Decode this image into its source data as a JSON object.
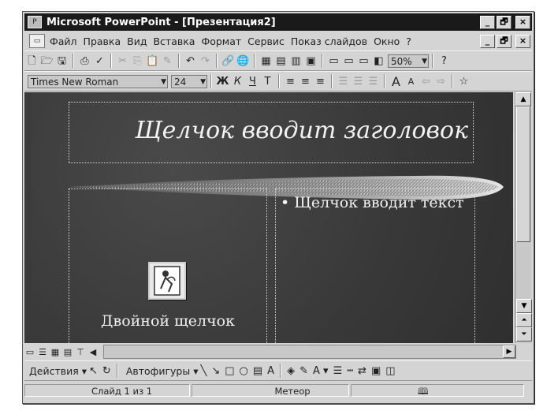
{
  "window": {
    "title": "Microsoft PowerPoint - [Презентация2]",
    "minimize": "_",
    "restore": "🗗",
    "close": "×"
  },
  "menu": {
    "items": [
      {
        "label": "Файл"
      },
      {
        "label": "Правка"
      },
      {
        "label": "Вид"
      },
      {
        "label": "Вставка"
      },
      {
        "label": "Формат"
      },
      {
        "label": "Сервис"
      },
      {
        "label": "Показ слайдов"
      },
      {
        "label": "Окно"
      },
      {
        "label": "?"
      }
    ]
  },
  "toolbar_standard": {
    "zoom": "50%"
  },
  "toolbar_format": {
    "font": "Times New Roman",
    "size": "24",
    "bold": "Ж",
    "italic": "К",
    "underline": "Ч",
    "shadow": "Т",
    "grow_font": "A",
    "shrink_font": "A"
  },
  "slide": {
    "title_placeholder": "Щелчок вводит заголовок",
    "bullet_placeholder": "Щелчок вводит текст",
    "object_placeholder": "Двойной щелчок"
  },
  "drawing_toolbar": {
    "actions": "Действия",
    "autoshapes": "Автофигуры",
    "text_color": "A"
  },
  "statusbar": {
    "slide": "Слайд 1 из 1",
    "design": "Метеор"
  }
}
